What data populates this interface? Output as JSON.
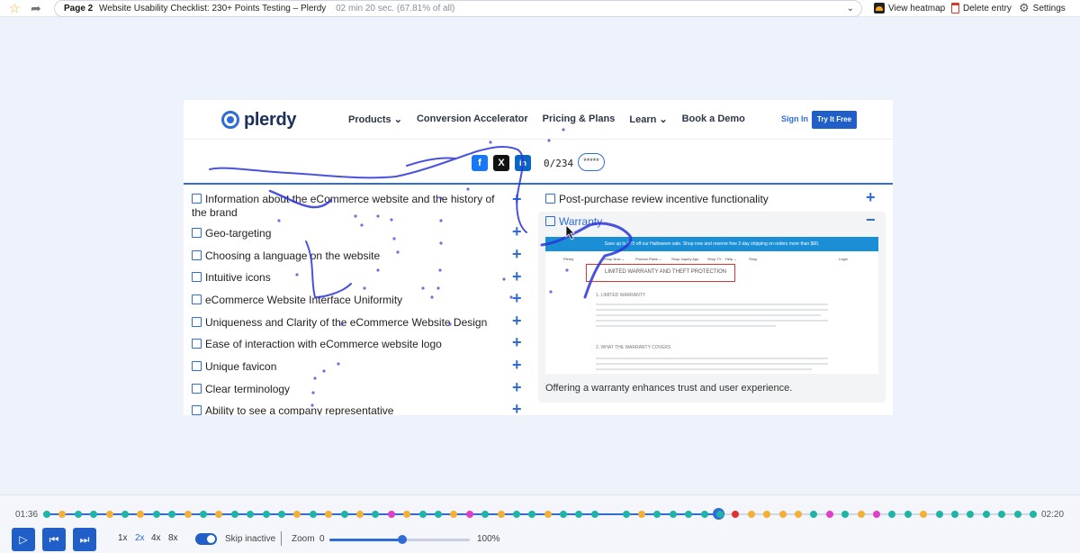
{
  "topbar": {
    "page_label": "Page 2",
    "page_title": "Website Usability Checklist: 230+ Points Testing – Plerdy",
    "duration": "02 min 20 sec. (67.81% of all)",
    "view_heatmap": "View heatmap",
    "delete_entry": "Delete entry",
    "settings": "Settings"
  },
  "site": {
    "logo": "plerdy",
    "nav": [
      "Products ⌄",
      "Conversion Accelerator",
      "Pricing & Plans",
      "Learn ⌄",
      "Book a Demo"
    ],
    "sign_in": "Sign In",
    "try_free": "Try It Free",
    "counter": "0/234",
    "pill": "*****",
    "social": [
      "f",
      "X",
      "in"
    ]
  },
  "checklist_left": [
    "Information about the eCommerce website and the history of the brand",
    "Geo-targeting",
    "Choosing a language on the website",
    "Intuitive icons",
    "eCommerce Website Interface Uniformity",
    "Uniqueness and Clarity of the eCommerce Website Design",
    "Ease of interaction with eCommerce website logo",
    "Unique favicon",
    "Clear terminology",
    "Ability to see a company representative"
  ],
  "checklist_right": {
    "item1": "Post-purchase review incentive functionality",
    "item2": "Warranty",
    "card_caption": "Offering a warranty enhances trust and user experience.",
    "shot_banner": "Save up to $70 off our Halloween sale. Shop now and reserve free 2-day shipping on orders more than $60.",
    "shot_heading": "LIMITED WARRANTY AND THEFT PROTECTION",
    "shot_sub1": "1. LIMITED WARRANTY",
    "shot_sub2": "2. WHAT THE WARRANTY COVERS",
    "shot_nav": [
      "Plerdy",
      "Shop Now ⌄",
      "Product Plans ⌄",
      "Shop Inquiry App",
      "Shop TV",
      "Help ⌄",
      "Shop",
      "Login"
    ]
  },
  "player": {
    "time_start": "01:36",
    "time_end": "02:20",
    "speeds": [
      "1x",
      "2x",
      "4x",
      "8x"
    ],
    "active_speed": "2x",
    "skip_inactive": "Skip inactive",
    "zoom_label": "Zoom",
    "zoom_min": "0",
    "zoom_max": "100%",
    "progress": 0.68,
    "zoom_value": 0.52,
    "colors": {
      "teal": "#1fb5a6",
      "orange": "#f2b134",
      "magenta": "#e040c8",
      "red": "#e03131",
      "blue": "#2f6cd6"
    },
    "event_colors": [
      "teal",
      "orange",
      "teal",
      "teal",
      "orange",
      "teal",
      "orange",
      "teal",
      "teal",
      "orange",
      "teal",
      "orange",
      "teal",
      "teal",
      "teal",
      "teal",
      "orange",
      "teal",
      "orange",
      "teal",
      "orange",
      "teal",
      "magenta",
      "orange",
      "teal",
      "teal",
      "orange",
      "magenta",
      "teal",
      "orange",
      "teal",
      "teal",
      "orange",
      "teal",
      "teal",
      "teal",
      "blue",
      "teal",
      "orange",
      "teal",
      "teal",
      "teal",
      "teal",
      "teal",
      "red",
      "orange",
      "orange",
      "orange",
      "orange",
      "teal",
      "magenta",
      "teal",
      "orange",
      "magenta",
      "teal",
      "teal",
      "orange",
      "teal",
      "teal",
      "teal",
      "teal",
      "teal",
      "teal",
      "teal"
    ]
  }
}
